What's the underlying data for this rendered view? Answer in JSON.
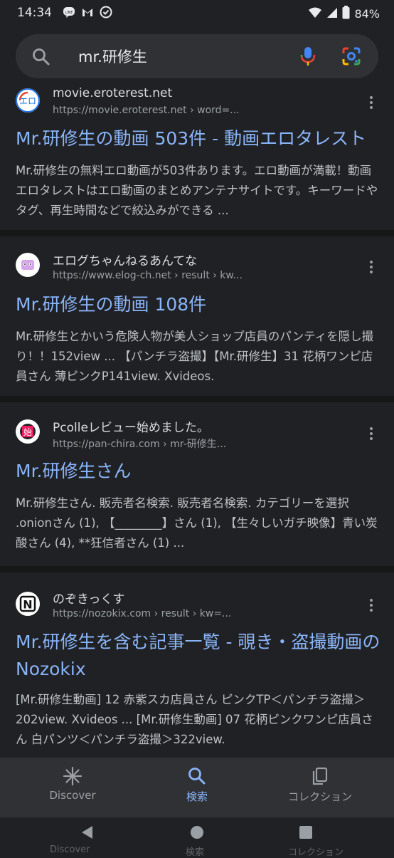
{
  "status_bar": {
    "time": "14:34",
    "battery": "84%",
    "left_icons": [
      "line-icon",
      "gmail-icon",
      "check-circle-icon"
    ],
    "right_icons": [
      "wifi-icon",
      "signal-icon",
      "battery-icon"
    ]
  },
  "search": {
    "query": "mr.研修生"
  },
  "results": [
    {
      "site_name": "movie.eroterest.net",
      "url": "https://movie.eroterest.net › word=...",
      "title": "Mr.研修生の動画 503件 - 動画エロタレスト",
      "snippet": "Mr.研修生の無料エロ動画が503件あります。エロ動画が満載！動画エロタレストはエロ動画のまとめアンテナサイトです。キーワードやタグ、再生時間などで絞込みができる ...",
      "favicon_text": "エロ"
    },
    {
      "site_name": "エログちゃんねるあんてな",
      "url": "https://www.elog-ch.net › result › kw...",
      "title": "Mr.研修生の動画 108件",
      "snippet": "Mr.研修生とかいう危険人物が美人ショップ店員のパンティを隠し撮り！！152view ... 【パンチラ盗撮】【Mr.研修生】31 花柄ワンピ店員さん 薄ピンクP141view. Xvideos.",
      "favicon_text": ""
    },
    {
      "site_name": "Pcolleレビュー始めました。",
      "url": "https://pan-chira.com › mr-研修生...",
      "title": "Mr.研修生さん",
      "snippet": "Mr.研修生さん. 販売者名検索. 販売者名検索. カテゴリーを選択 .onionさん (1), 【________】さん (1), 【生々しいガチ映像】青い炭酸さん (4), **狂信者さん (1) ...",
      "favicon_text": "始"
    },
    {
      "site_name": "のぞきっくす",
      "url": "https://nozokix.com › result › kw=...",
      "title": "Mr.研修生を含む記事一覧 - 覗き・盗撮動画のNozokix",
      "snippet": "[Mr.研修生動画] 12 赤紫スカ店員さん ピンクTP＜パンチラ盗撮＞202view. Xvideos ... [Mr.研修生動画] 07 花柄ピンクワンピ店員さん 白パンツ＜パンチラ盗撮＞322view.",
      "favicon_text": "N"
    }
  ],
  "bottom_nav": [
    {
      "label": "Discover",
      "icon": "asterisk-icon",
      "active": false
    },
    {
      "label": "検索",
      "icon": "search-icon",
      "active": true
    },
    {
      "label": "コレクション",
      "icon": "collections-icon",
      "active": false
    }
  ],
  "ghost_labels": [
    "Discover",
    "検索",
    "コレクション"
  ],
  "colors": {
    "background": "#202124",
    "link": "#8ab4f8",
    "text": "#bdc1c6",
    "nav_bar": "#303134"
  }
}
